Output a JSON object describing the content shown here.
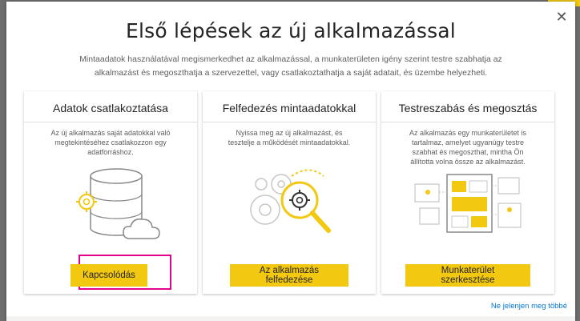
{
  "dialog": {
    "title": "Első lépések az új alkalmazással",
    "subtitle": "Mintaadatok használatával megismerkedhet az alkalmazással, a munkaterületen igény szerint testre szabhatja az alkalmazást és megoszthatja a szervezettel, vagy csatlakoztathatja a saját adatait, és üzembe helyezheti.",
    "close_icon": "close-icon",
    "dont_show_label": "Ne jelenjen meg többé"
  },
  "cards": [
    {
      "title": "Adatok csatlakoztatása",
      "description": "Az új alkalmazás saját adatokkal való megtekintéséhez csatlakozzon egy adatforráshoz.",
      "button_label": "Kapcsolódás",
      "illustration": "database-cloud-illustration"
    },
    {
      "title": "Felfedezés mintaadatokkal",
      "description": "Nyissa meg az új alkalmazást, és tesztelje a működését mintaadatokkal.",
      "button_label": "Az alkalmazás felfedezése",
      "illustration": "gears-magnifier-illustration"
    },
    {
      "title": "Testreszabás és megosztás",
      "description": "Az alkalmazás egy munkaterületet is tartalmaz, amelyet ugyanúgy testre szabhat és megoszthat, mintha Ön állította volna össze az alkalmazást.",
      "button_label": "Munkaterület szerkesztése",
      "illustration": "dashboard-illustration"
    }
  ],
  "colors": {
    "accent": "#f2c811",
    "focus_ring": "#e3008c",
    "link": "#0078d4"
  }
}
